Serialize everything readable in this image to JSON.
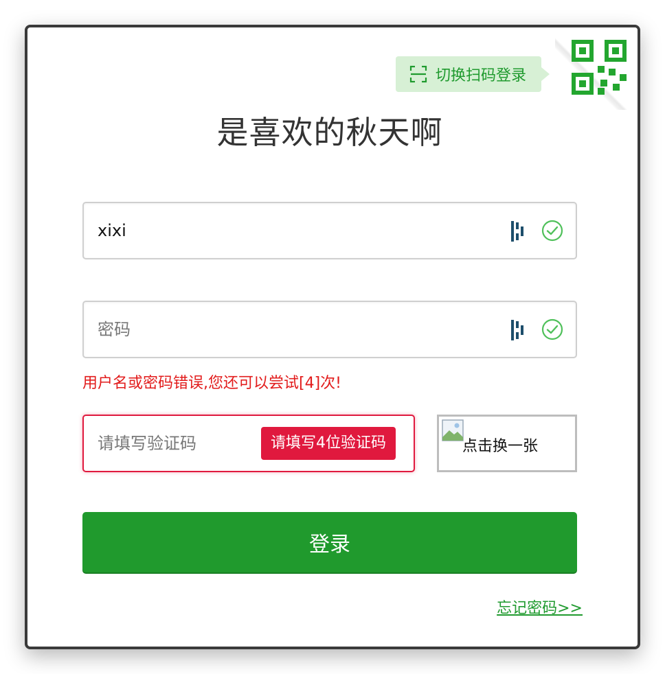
{
  "qr_switch": {
    "label": "切换扫码登录"
  },
  "title": "是喜欢的秋天啊",
  "username": {
    "value": "xixi"
  },
  "password": {
    "placeholder": "密码"
  },
  "error": {
    "message": "用户名或密码错误,您还可以尝试[4]次!"
  },
  "captcha": {
    "placeholder": "请填写验证码",
    "tip": "请填写4位验证码",
    "image_alt": "点击换一张"
  },
  "login_button": {
    "label": "登录"
  },
  "forgot_link": {
    "label": "忘记密码>>"
  },
  "colors": {
    "accent_green": "#209a2d",
    "error_red": "#e0193e"
  }
}
